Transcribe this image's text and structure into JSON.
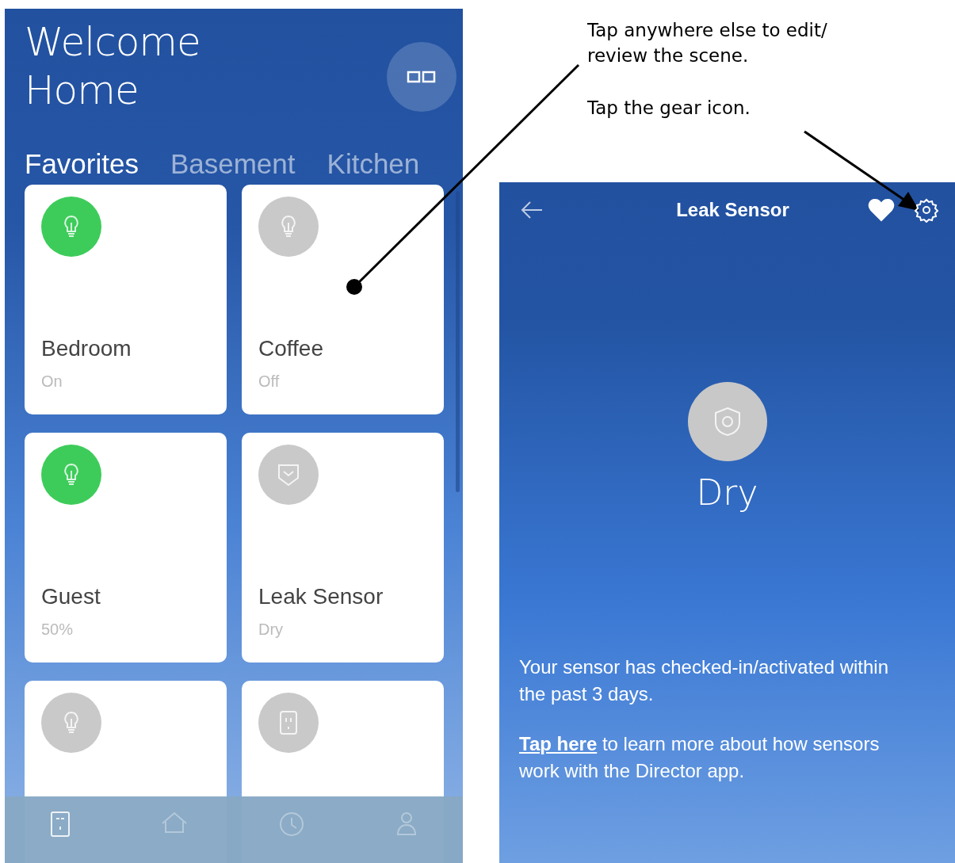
{
  "home_screen": {
    "title": "Welcome Home",
    "tabs": [
      {
        "label": "Favorites",
        "selected": true
      },
      {
        "label": "Basement",
        "selected": false
      },
      {
        "label": "Kitchen",
        "selected": false
      }
    ],
    "cards": [
      {
        "name": "Bedroom",
        "status": "On",
        "kind": "bulb",
        "on": true
      },
      {
        "name": "Coffee",
        "status": "Off",
        "kind": "bulb",
        "on": false
      },
      {
        "name": "Guest",
        "status": "50%",
        "kind": "bulb",
        "on": true
      },
      {
        "name": "Leak Sensor",
        "status": "Dry",
        "kind": "shield",
        "on": false
      },
      {
        "kind": "bulb",
        "on": false
      },
      {
        "kind": "outlet",
        "on": false
      }
    ],
    "bottom_nav": [
      {
        "kind": "device",
        "selected": true
      },
      {
        "kind": "home",
        "selected": false
      },
      {
        "kind": "clock",
        "selected": false
      },
      {
        "kind": "person",
        "selected": false
      }
    ]
  },
  "annotations": [
    "Tap anywhere else to edit/ review the scene.",
    "Tap the gear icon."
  ],
  "sensor_screen": {
    "title": "Leak Sensor",
    "favorite": true,
    "state": "Dry",
    "info": "Your sensor has checked-in/activated within the past 3 days.",
    "link": "Tap here",
    "link_text": " to learn more about how sensors work with the Director app."
  }
}
